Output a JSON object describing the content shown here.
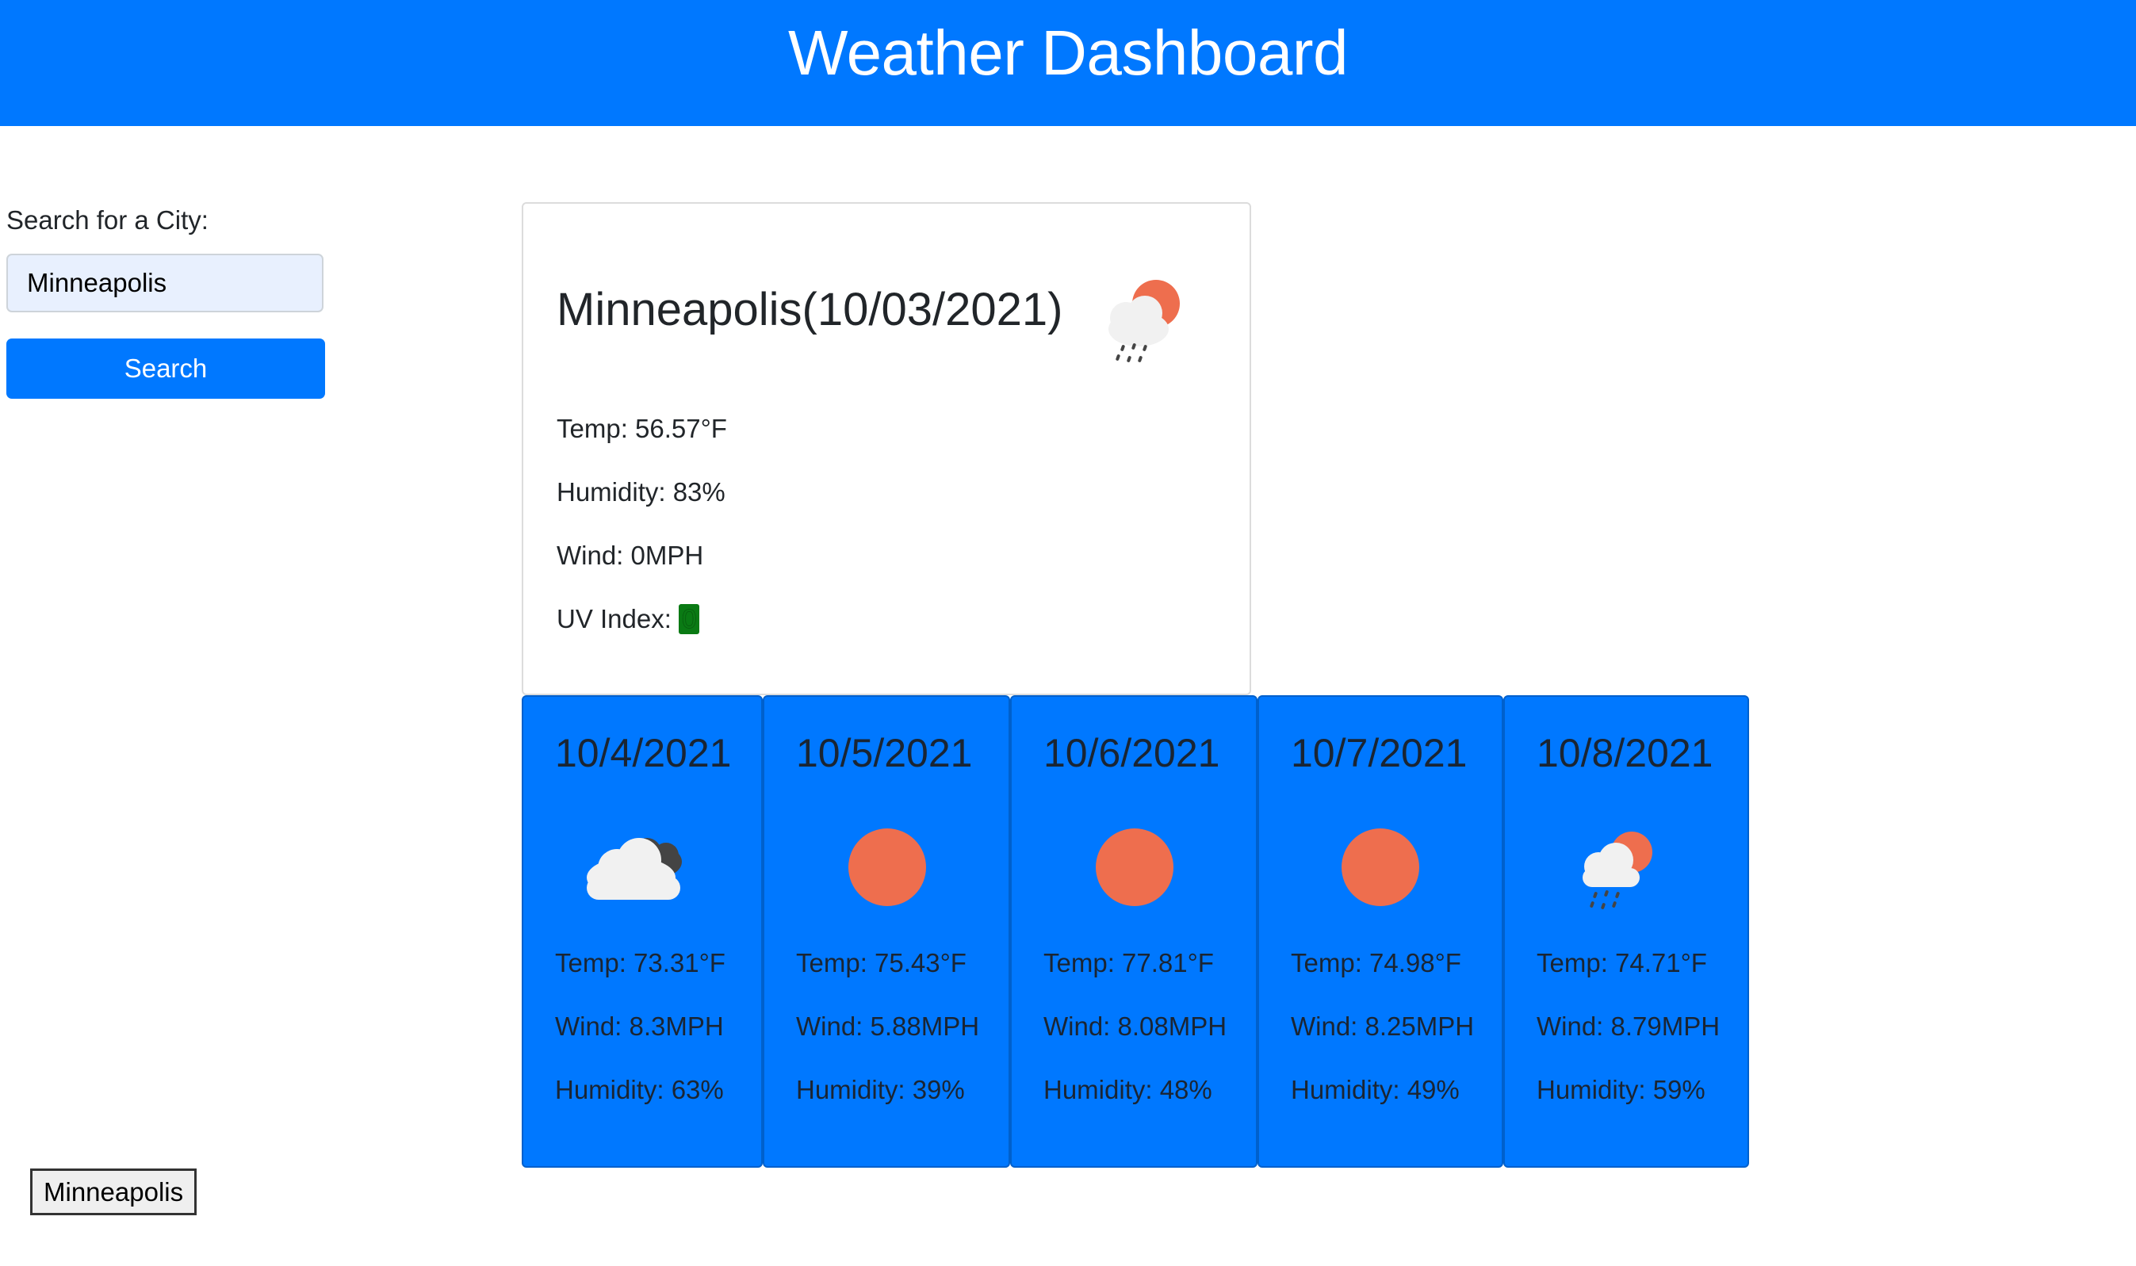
{
  "header": {
    "title": "Weather Dashboard"
  },
  "search": {
    "label": "Search for a City:",
    "value": "Minneapolis",
    "button_label": "Search",
    "history": [
      "Minneapolis"
    ]
  },
  "current": {
    "title": "Minneapolis(10/03/2021)",
    "icon": "sun-cloud-rain-icon",
    "temp": "Temp: 56.57°F",
    "humidity": "Humidity: 83%",
    "wind": "Wind: 0MPH",
    "uv_label": "UV Index: ",
    "uv_value": "0",
    "uv_color": "#0a7a14"
  },
  "forecast": [
    {
      "date": "10/4/2021",
      "icon": "broken-clouds-icon",
      "temp": "Temp: 73.31°F",
      "wind": "Wind: 8.3MPH",
      "humidity": "Humidity: 63%"
    },
    {
      "date": "10/5/2021",
      "icon": "sun-icon",
      "temp": "Temp: 75.43°F",
      "wind": "Wind: 5.88MPH",
      "humidity": "Humidity: 39%"
    },
    {
      "date": "10/6/2021",
      "icon": "sun-icon",
      "temp": "Temp: 77.81°F",
      "wind": "Wind: 8.08MPH",
      "humidity": "Humidity: 48%"
    },
    {
      "date": "10/7/2021",
      "icon": "sun-icon",
      "temp": "Temp: 74.98°F",
      "wind": "Wind: 8.25MPH",
      "humidity": "Humidity: 49%"
    },
    {
      "date": "10/8/2021",
      "icon": "sun-cloud-rain-icon",
      "temp": "Temp: 74.71°F",
      "wind": "Wind: 8.79MPH",
      "humidity": "Humidity: 59%"
    }
  ],
  "colors": {
    "primary": "#0078ff",
    "sun": "#ee6e4e",
    "cloud": "#f1f1f1",
    "dark_cloud": "#444444"
  }
}
